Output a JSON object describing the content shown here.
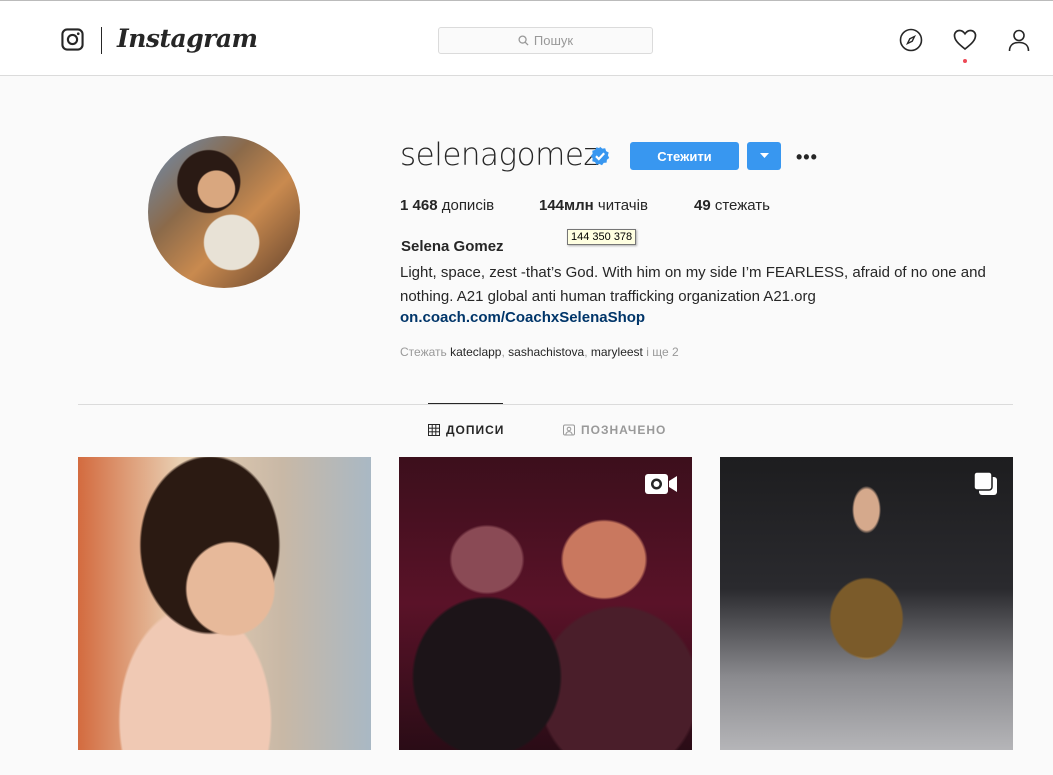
{
  "nav": {
    "brand": "Instagram",
    "search_placeholder": "Пошук"
  },
  "profile": {
    "username": "selenagomez",
    "follow_label": "Стежити",
    "more_label": "•••",
    "stats": {
      "posts_count": "1 468",
      "posts_label": "дописів",
      "followers_count": "144млн",
      "followers_label": "читачів",
      "following_count": "49",
      "following_label": "стежать"
    },
    "followers_tooltip": "144 350 378",
    "full_name": "Selena Gomez",
    "bio": "Light, space, zest -that’s God. With him on my side I’m FEARLESS, afraid of no one and nothing. A21 global anti human trafficking organization A21.org",
    "link": "on.coach.com/CoachxSelenaShop",
    "followed_by_prefix": "Стежать",
    "followed_by": [
      "kateclapp",
      "sashachistova",
      "maryleest"
    ],
    "followed_by_more": "і ще 2"
  },
  "tabs": [
    {
      "label": "ДОПИСИ",
      "icon": "grid-icon",
      "active": true
    },
    {
      "label": "ПОЗНАЧЕНО",
      "icon": "tagged-icon",
      "active": false
    }
  ],
  "posts": [
    {
      "type": "photo"
    },
    {
      "type": "video",
      "badge_icon": "video-icon"
    },
    {
      "type": "carousel",
      "badge_icon": "carousel-icon"
    }
  ],
  "colors": {
    "accent": "#3897f0",
    "link": "#003569",
    "notification_dot": "#ed4956"
  }
}
